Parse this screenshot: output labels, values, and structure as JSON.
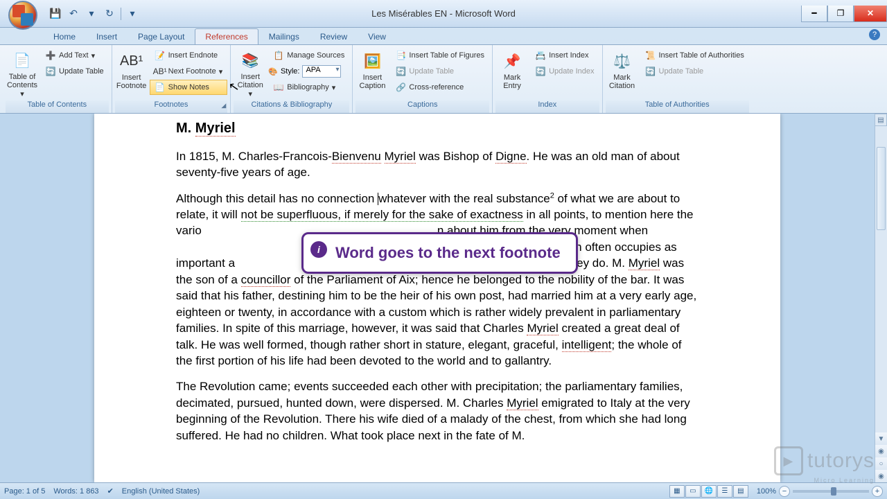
{
  "title": "Les Misérables EN - Microsoft Word",
  "qat": {
    "save": "💾",
    "undo": "↶",
    "redo": "↻"
  },
  "tabs": [
    "Home",
    "Insert",
    "Page Layout",
    "References",
    "Mailings",
    "Review",
    "View"
  ],
  "active_tab": "References",
  "ribbon": {
    "toc": {
      "label": "Table of Contents",
      "big": "Table of Contents",
      "add_text": "Add Text",
      "update": "Update Table"
    },
    "footnotes": {
      "label": "Footnotes",
      "big": "Insert Footnote",
      "insert_endnote": "Insert Endnote",
      "next_footnote": "Next Footnote",
      "show_notes": "Show Notes"
    },
    "citations": {
      "label": "Citations & Bibliography",
      "big": "Insert Citation",
      "manage": "Manage Sources",
      "style_label": "Style:",
      "style_value": "APA",
      "bibliography": "Bibliography"
    },
    "captions": {
      "label": "Captions",
      "big": "Insert Caption",
      "insert_tof": "Insert Table of Figures",
      "update": "Update Table",
      "crossref": "Cross-reference"
    },
    "index": {
      "label": "Index",
      "big": "Mark Entry",
      "insert": "Insert Index",
      "update": "Update Index"
    },
    "toa": {
      "label": "Table of Authorities",
      "big": "Mark Citation",
      "insert": "Insert Table of Authorities",
      "update": "Update Table"
    }
  },
  "document": {
    "heading": "M. Myriel",
    "p1_a": "In 1815, M. Charles-Francois-",
    "p1_b": "Bienvenu",
    "p1_c": " ",
    "p1_d": "Myriel",
    "p1_e": " was Bishop of ",
    "p1_f": "Digne",
    "p1_g": ". He was an old man of about seventy-five years of age.",
    "p2_a": "Although this detail has no connection ",
    "p2_b": "whatever with the real substance",
    "p2_fn": "2",
    "p2_c": " of what we are about to relate, it will ",
    "p2_d": "not be superfluous, if merely for the sake of exactness",
    "p2_e": " in all points, to mention here the vario",
    "p2_f": "n about him from the very moment when",
    "p2_g": "is said of men often occupies as important a",
    "p2_h": ", as that which they do. M. ",
    "p2_i": "Myriel",
    "p2_j": " was the son of a ",
    "p2_k": "councillor",
    "p2_l": " of the Parliament of Aix; hence he belonged to the nobility of the bar. It was said that his father, destining him to be the heir of his own post, had married him at a very early age, eighteen or twenty, in accordance with a custom which is rather widely prevalent in parliamentary families. In spite of this marriage, however, it was said that Charles ",
    "p2_m": "Myriel",
    "p2_n": " created a great deal of talk. He was well formed, though rather short in stature, elegant, graceful, ",
    "p2_o": "intelligent",
    "p2_p": "; the whole of the first portion of his life had been devoted to the world and to gallantry.",
    "p3_a": "The Revolution came; events succeeded each other with precipitation; the parliamentary families, decimated, pursued, hunted down, were dispersed. M. Charles ",
    "p3_b": "Myriel",
    "p3_c": " emigrated to Italy at the very beginning of the Revolution. There his wife died of a malady of the chest, from which she had long suffered. He had no children. What took place next in the fate of M."
  },
  "overlay": {
    "text": "Word goes to the next footnote"
  },
  "status": {
    "page": "Page: 1 of 5",
    "words": "Words: 1 863",
    "lang": "English (United States)",
    "zoom": "100%"
  },
  "watermark": {
    "brand": "tutorys",
    "sub": "Micro Learning"
  }
}
